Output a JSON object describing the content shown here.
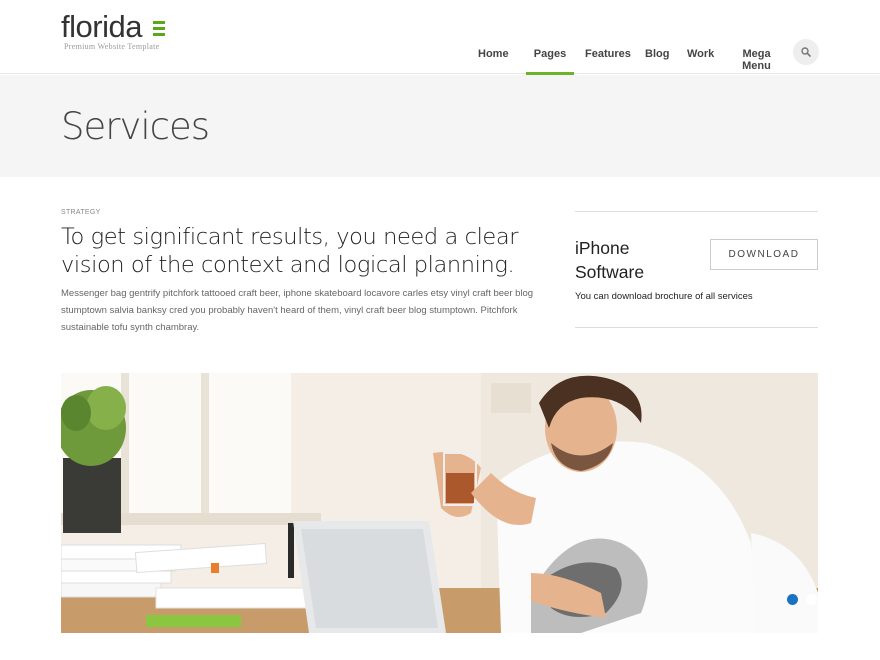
{
  "brand": {
    "name": "florida",
    "tagline": "Premium Website Template",
    "accent_color": "#6bb329"
  },
  "nav": {
    "items": [
      {
        "label": "Home"
      },
      {
        "label": "Pages",
        "active": true
      },
      {
        "label": "Features"
      },
      {
        "label": "Blog"
      },
      {
        "label": "Work"
      },
      {
        "label": "Mega Menu"
      }
    ],
    "search_icon": "search-icon"
  },
  "page": {
    "title": "Services"
  },
  "content": {
    "eyebrow": "STRATEGY",
    "headline": "To get significant results, you need a clear vision of the context and logical planning.",
    "body": "Messenger bag gentrify pitchfork tattooed craft beer, iphone skateboard locavore carles etsy vinyl craft beer blog stumptown salvia banksy cred you probably haven't heard of them, vinyl craft beer blog stumptown. Pitchfork sustainable tofu synth chambray."
  },
  "promo": {
    "title": "iPhone Software",
    "button_label": "DOWNLOAD",
    "text": "You can download brochure of all services"
  },
  "slider": {
    "slides": 3,
    "active_index": 0,
    "dot_active_color": "#1a73c1"
  }
}
